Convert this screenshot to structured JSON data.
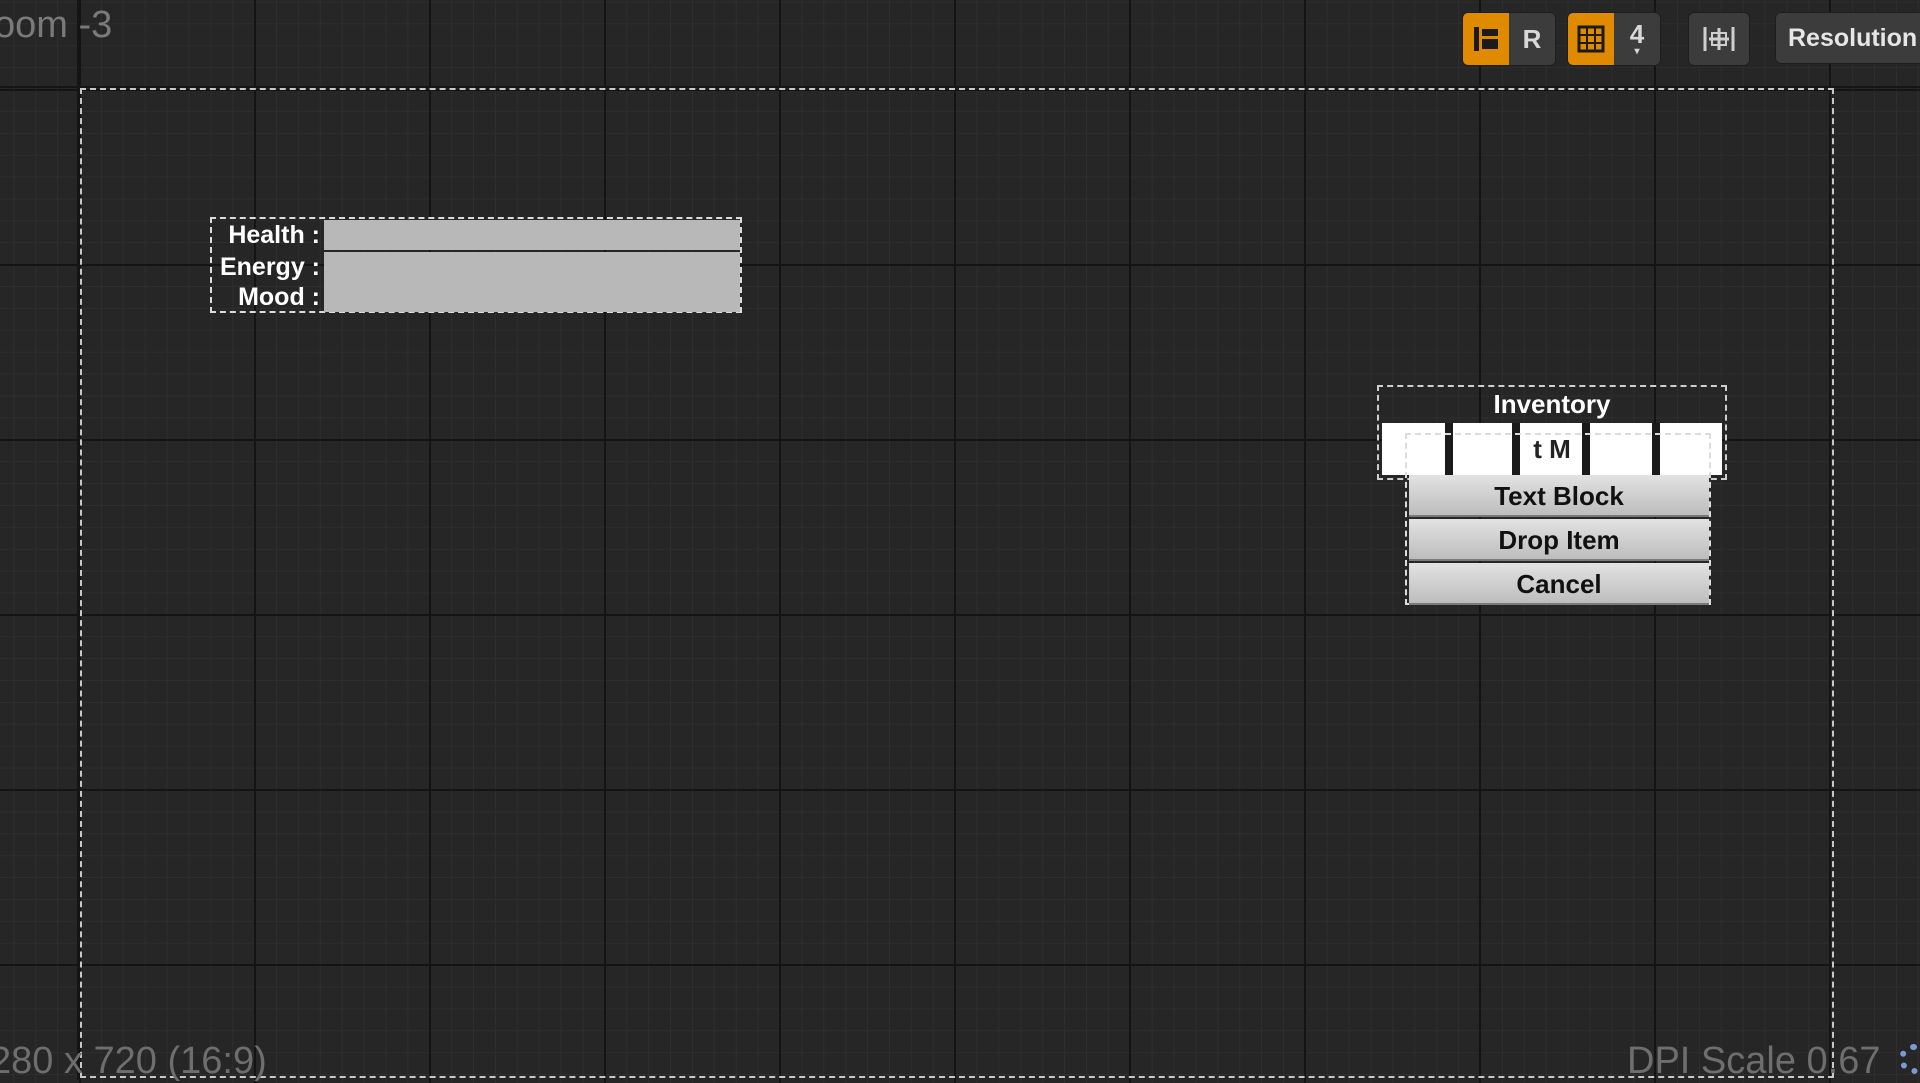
{
  "viewport": {
    "zoom_label": "oom -3",
    "resolution_readout": "280 x 720 (16:9)",
    "dpi_readout": "DPI Scale 0.67"
  },
  "toolbar": {
    "respect_locks_label": "R",
    "grid_snap_value": "4",
    "resolution_label": "Resolution"
  },
  "stats": [
    {
      "label": "Health :",
      "value": 0
    },
    {
      "label": "Energy :",
      "value": 0
    },
    {
      "label": "Mood :",
      "value": 0
    }
  ],
  "inventory": {
    "title": "Inventory",
    "slot_text": "t M"
  },
  "context_menu": {
    "items": [
      "Text Block",
      "Drop Item",
      "Cancel"
    ]
  },
  "colors": {
    "accent": "#e08a00",
    "background": "#262626"
  }
}
